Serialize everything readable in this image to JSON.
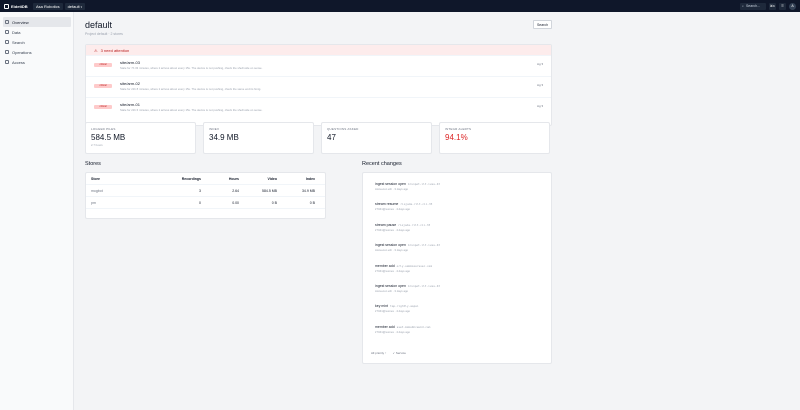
{
  "topbar": {
    "brand": "EidetiDB",
    "org": "Asa Robotics",
    "project": "default",
    "search_placeholder": "Search...",
    "shortcut": "⌘K",
    "avatar_initial": "A"
  },
  "sidebar": {
    "items": [
      {
        "label": "Overview",
        "icon": "grid-icon",
        "active": true
      },
      {
        "label": "Data",
        "icon": "database-icon"
      },
      {
        "label": "Search",
        "icon": "search-icon"
      },
      {
        "label": "Operations",
        "icon": "operations-icon"
      },
      {
        "label": "Access",
        "icon": "access-icon"
      }
    ]
  },
  "page": {
    "title": "default",
    "subtitle": "Project default · 2 stores",
    "search_button": "Search"
  },
  "attention": {
    "heading": "3 need attention",
    "items": [
      {
        "status": "critical",
        "name": "site/arm-03",
        "desc": "Stale for 7h 33 minutes, where it arrives about every 15s. The device is not pushing, check the shelf-side on sense.",
        "control": "Ag"
      },
      {
        "status": "critical",
        "name": "site/arm-02",
        "desc": "Stale for 21h 8 minutes, where it arrives about every 15s. The device is not pushing, check the same end its hmtg.",
        "control": "Ag"
      },
      {
        "status": "critical",
        "name": "site/arm-01",
        "desc": "Stale for 21h 6 minutes, where it arrives about every 15s. The device is not pushing, check the shelf-side on sense.",
        "control": "Ag"
      }
    ]
  },
  "stats": [
    {
      "label": "LOGGED PILES",
      "value": "584.5 MB",
      "sub": "2.7 hours",
      "red": false
    },
    {
      "label": "INDEX",
      "value": "34.9 MB",
      "sub": "",
      "red": false
    },
    {
      "label": "QUESTIONS ASKED",
      "value": "47",
      "sub": "",
      "red": false
    },
    {
      "label": "INTEGR ALERTS",
      "value": "94.1%",
      "sub": "",
      "red": true
    }
  ],
  "stores": {
    "title": "Stores",
    "headers": {
      "store": "Store",
      "recordings": "Recordings",
      "hours": "Hours",
      "video": "Video",
      "index": "Index"
    },
    "rows": [
      {
        "store": "mogbot",
        "recordings": "3",
        "hours": "2.64",
        "video": "584.5 MB",
        "index": "34.9 MB"
      },
      {
        "store": "pm",
        "recordings": "0",
        "hours": "0.00",
        "video": "0 B",
        "index": "0 B"
      }
    ]
  },
  "recent": {
    "title": "Recent changes",
    "items": [
      {
        "action": "ingest session open",
        "detail": "brunpot-ilt-ives-43",
        "meta": "Accuecon eth · 3 days ago"
      },
      {
        "action": "stream resume",
        "detail": "riojade-rilt-cii-33",
        "meta": "ir7041@sumes · 4 days ago"
      },
      {
        "action": "stream pause",
        "detail": "riojade-rilt-cii-33",
        "meta": "ir7041@sumes · 4 days ago"
      },
      {
        "action": "ingest session open",
        "detail": "brunpot-ilt-ives-43",
        "meta": "Accuecon eth · 3 days ago"
      },
      {
        "action": "member add",
        "detail": "orly-sabmxoorsuec.com",
        "meta": "ir7041@sumes · 4 days ago"
      },
      {
        "action": "ingest session open",
        "detail": "brunpot-ilt-ives-43",
        "meta": "Accuecon eth · 3 days ago"
      },
      {
        "action": "key mint",
        "detail": "tap-rightly-aopsi",
        "meta": "ir7041@sumes · 4 days ago"
      },
      {
        "action": "member add",
        "detail": "sset-mobobhceukd.com",
        "meta": "ir7041@sumes · 4 days ago"
      }
    ],
    "foot_left": "All priority ↑",
    "foot_right": "✓ Service"
  }
}
